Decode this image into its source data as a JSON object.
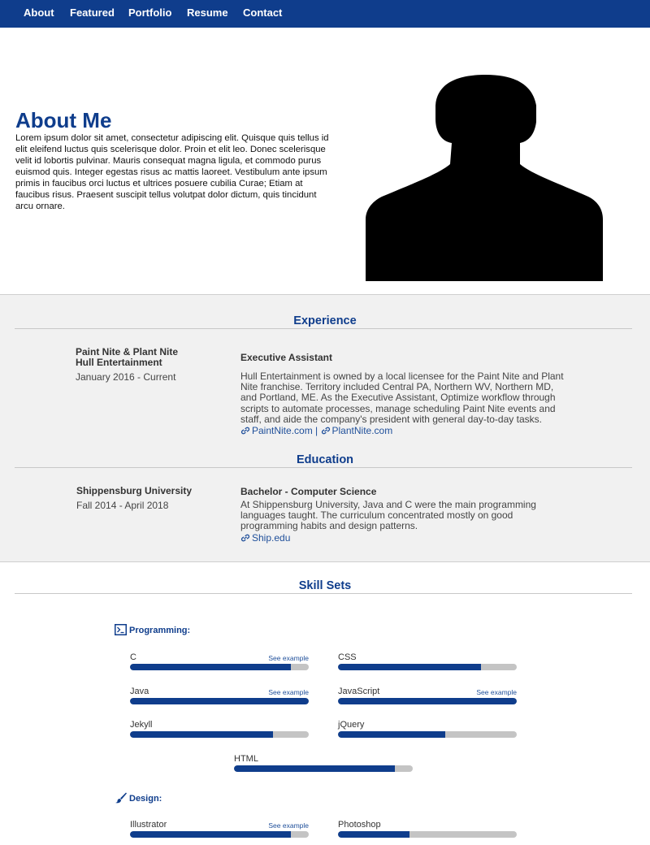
{
  "nav": [
    "About",
    "Featured",
    "Portfolio",
    "Resume",
    "Contact"
  ],
  "about": {
    "title": "About Me",
    "text": "Lorem ipsum dolor sit amet, consectetur adipiscing elit. Quisque quis tellus id elit eleifend luctus quis scelerisque dolor. Proin et elit leo. Donec scelerisque velit id lobortis pulvinar. Mauris consequat magna ligula, et commodo purus euismod quis. Integer egestas risus ac mattis laoreet. Vestibulum ante ipsum primis in faucibus orci luctus et ultrices posuere cubilia Curae; Etiam at faucibus risus. Praesent suscipit tellus volutpat dolor dictum, quis tincidunt arcu ornare."
  },
  "experience": {
    "title": "Experience",
    "org_line1": "Paint Nite & Plant Nite",
    "org_line2": "Hull Entertainment",
    "dates": "January 2016 - Current",
    "role": "Executive Assistant",
    "description": "Hull Entertainment is owned by a local licensee for the Paint Nite and Plant Nite franchise. Territory included Central PA, Northern WV, Northern MD, and Portland, ME. As the Executive Assistant, Optimize workflow through scripts to automate processes, manage scheduling Paint Nite events and staff, and aide the company's president with general day-to-day tasks.",
    "link1": "PaintNite.com",
    "separator": "|",
    "link2": "PlantNite.com"
  },
  "education": {
    "title": "Education",
    "school": "Shippensburg University",
    "dates": "Fall 2014 - April 2018",
    "degree": "Bachelor - Computer Science",
    "description": "At Shippensburg University, Java and C were the main programming languages taught. The curriculum concentrated mostly on good programming habits and design patterns.",
    "link": "Ship.edu"
  },
  "skills": {
    "title": "Skill Sets",
    "programming_label": "Programming:",
    "design_label": "Design:",
    "example_label": "See example",
    "programming": [
      {
        "name": "C",
        "level": 0.9,
        "example": true
      },
      {
        "name": "CSS",
        "level": 0.8,
        "example": false
      },
      {
        "name": "Java",
        "level": 1.0,
        "example": true
      },
      {
        "name": "JavaScript",
        "level": 1.0,
        "example": true
      },
      {
        "name": "Jekyll",
        "level": 0.8,
        "example": false
      },
      {
        "name": "jQuery",
        "level": 0.6,
        "example": false
      },
      {
        "name": "HTML",
        "level": 0.9,
        "example": false
      }
    ],
    "design": [
      {
        "name": "Illustrator",
        "level": 0.9,
        "example": true
      },
      {
        "name": "Photoshop",
        "level": 0.4,
        "example": false
      }
    ]
  },
  "colors": {
    "brand": "#0f3d8c",
    "track": "#c4c4c4",
    "section_bg": "#f1f1f1"
  }
}
